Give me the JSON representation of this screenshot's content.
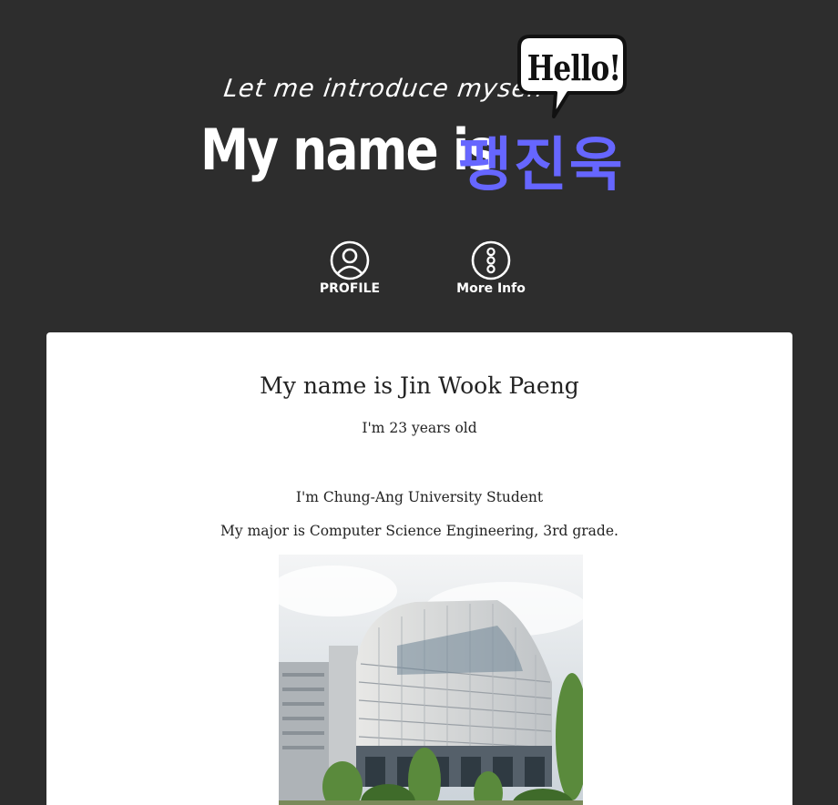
{
  "hero": {
    "intro": "Let me introduce myself",
    "name_prefix": "My name is",
    "name_korean": "팽진욱",
    "bubble": "Hello!"
  },
  "nav": {
    "profile": {
      "label": "PROFILE",
      "icon": "user-circle-icon"
    },
    "more_info": {
      "label": "More Info",
      "icon": "more-dots-icon"
    }
  },
  "card": {
    "title": "My name is Jin Wook Paeng",
    "age": "I'm 23 years old",
    "school": "I'm Chung-Ang University Student",
    "major": "My major is Computer Science Engineering, 3rd grade."
  },
  "colors": {
    "background": "#2d2d2d",
    "accent": "#6666ff",
    "card": "#ffffff"
  }
}
